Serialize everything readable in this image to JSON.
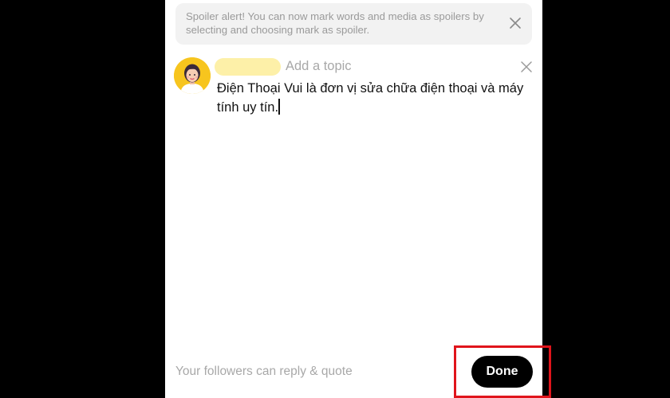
{
  "banner": {
    "text": "Spoiler alert! You can now mark words and media as spoilers by selecting and choosing mark as spoiler.",
    "close_icon": "close-icon"
  },
  "composer": {
    "avatar_icon": "user-avatar",
    "topic_placeholder": "Add a topic",
    "close_icon": "close-icon",
    "post_text": "Điện Thoại Vui là đơn vị sửa chữa điện thoại và máy tính uy tín."
  },
  "footer": {
    "reply_setting": "Your followers can reply & quote",
    "done_label": "Done"
  },
  "colors": {
    "highlight": "#e0141b",
    "avatar_bg": "#f7c51e"
  }
}
